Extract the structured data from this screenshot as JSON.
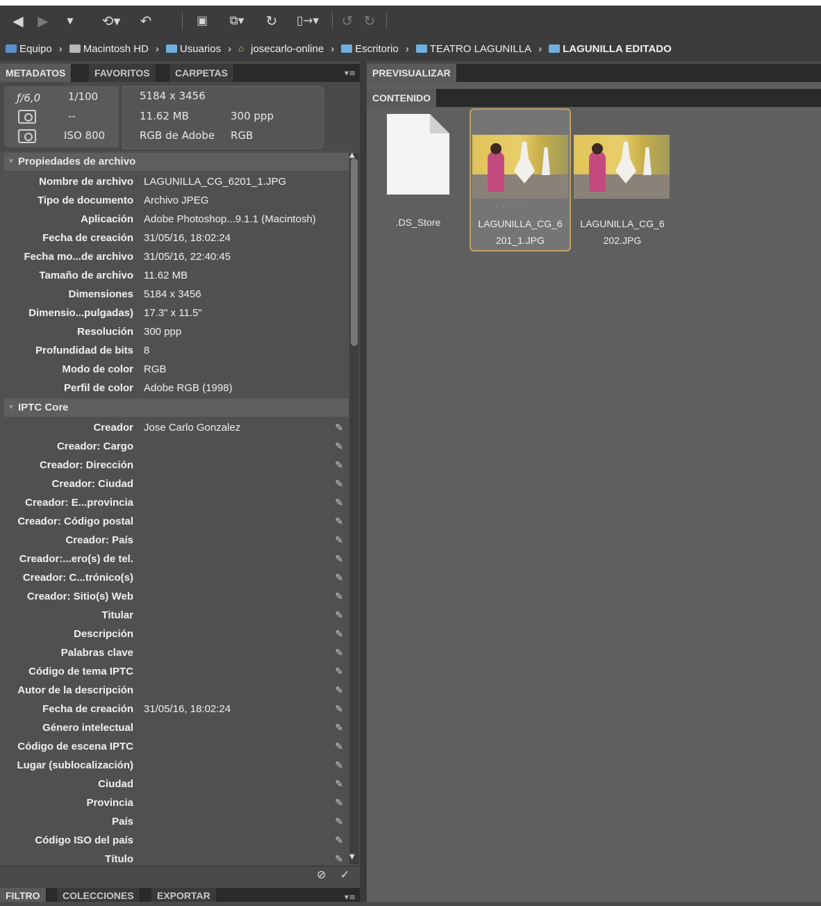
{
  "toolbar": {
    "icons": [
      "back-arrow-icon",
      "forward-arrow-icon",
      "dropdown-icon",
      "boomerang-icon",
      "rotate-icon",
      "camera-import-icon",
      "copy-icon",
      "refresh-icon",
      "output-icon",
      "undo-icon",
      "redo-icon"
    ]
  },
  "breadcrumb": [
    {
      "label": "Equipo",
      "icon": "computer-icon"
    },
    {
      "label": "Macintosh HD",
      "icon": "hard-drive-icon"
    },
    {
      "label": "Usuarios",
      "icon": "folder-icon"
    },
    {
      "label": "josecarlo-online",
      "icon": "home-icon"
    },
    {
      "label": "Escritorio",
      "icon": "folder-icon"
    },
    {
      "label": "TEATRO LAGUNILLA",
      "icon": "folder-icon"
    },
    {
      "label": "LAGUNILLA EDITADO",
      "icon": "folder-icon"
    }
  ],
  "left_tabs": [
    "METADATOS",
    "FAVORITOS",
    "CARPETAS"
  ],
  "camera": {
    "aperture": "ƒ/6,0",
    "shutter": "1/100",
    "metering": "--",
    "iso": "ISO 800",
    "dimensions": "5184 x 3456",
    "size": "11.62 MB",
    "resolution": "300 ppp",
    "profile": "RGB de Adobe",
    "mode": "RGB"
  },
  "file_props": {
    "title": "Propiedades de archivo",
    "rows": [
      {
        "k": "Nombre de archivo",
        "v": "LAGUNILLA_CG_6201_1.JPG"
      },
      {
        "k": "Tipo de documento",
        "v": "Archivo JPEG"
      },
      {
        "k": "Aplicación",
        "v": "Adobe Photoshop...9.1.1 (Macintosh)"
      },
      {
        "k": "Fecha de creación",
        "v": "31/05/16, 18:02:24"
      },
      {
        "k": "Fecha mo...de archivo",
        "v": "31/05/16, 22:40:45"
      },
      {
        "k": "Tamaño de archivo",
        "v": "11.62 MB"
      },
      {
        "k": "Dimensiones",
        "v": "5184 x 3456"
      },
      {
        "k": "Dimensio...pulgadas)",
        "v": "17.3\" x 11.5\""
      },
      {
        "k": "Resolución",
        "v": "300 ppp"
      },
      {
        "k": "Profundidad de bits",
        "v": "8"
      },
      {
        "k": "Modo de color",
        "v": "RGB"
      },
      {
        "k": "Perfil de color",
        "v": "Adobe RGB (1998)"
      }
    ]
  },
  "iptc": {
    "title": "IPTC Core",
    "rows": [
      {
        "k": "Creador",
        "v": "Jose Carlo Gonzalez"
      },
      {
        "k": "Creador: Cargo",
        "v": ""
      },
      {
        "k": "Creador: Dirección",
        "v": ""
      },
      {
        "k": "Creador: Ciudad",
        "v": ""
      },
      {
        "k": "Creador: E...provincia",
        "v": ""
      },
      {
        "k": "Creador: Código postal",
        "v": ""
      },
      {
        "k": "Creador: País",
        "v": ""
      },
      {
        "k": "Creador:...ero(s) de tel.",
        "v": ""
      },
      {
        "k": "Creador: C...trónico(s)",
        "v": ""
      },
      {
        "k": "Creador: Sitio(s) Web",
        "v": ""
      },
      {
        "k": "Titular",
        "v": ""
      },
      {
        "k": "Descripción",
        "v": ""
      },
      {
        "k": "Palabras clave",
        "v": ""
      },
      {
        "k": "Código de tema IPTC",
        "v": ""
      },
      {
        "k": "Autor de la descripción",
        "v": ""
      },
      {
        "k": "Fecha de creación",
        "v": "31/05/16, 18:02:24"
      },
      {
        "k": "Género intelectual",
        "v": ""
      },
      {
        "k": "Código de escena IPTC",
        "v": ""
      },
      {
        "k": "Lugar (sublocalización)",
        "v": ""
      },
      {
        "k": "Ciudad",
        "v": ""
      },
      {
        "k": "Provincia",
        "v": ""
      },
      {
        "k": "País",
        "v": ""
      },
      {
        "k": "Código ISO del país",
        "v": ""
      },
      {
        "k": "Título",
        "v": ""
      }
    ]
  },
  "bottom_tabs": [
    "FILTRO",
    "COLECCIONES",
    "EXPORTAR"
  ],
  "preview_tab": "PREVISUALIZAR",
  "content_tab": "CONTENIDO",
  "files": [
    {
      "name1": ".DS_Store",
      "name2": "",
      "type": "document"
    },
    {
      "name1": "LAGUNILLA_CG_6",
      "name2": "201_1.JPG",
      "type": "photo",
      "selected": true
    },
    {
      "name1": "LAGUNILLA_CG_6",
      "name2": "202.JPG",
      "type": "photo"
    }
  ],
  "colors": {
    "selection": "#c4a25c",
    "panel": "#505050",
    "toolbar": "#3c3c3c"
  }
}
